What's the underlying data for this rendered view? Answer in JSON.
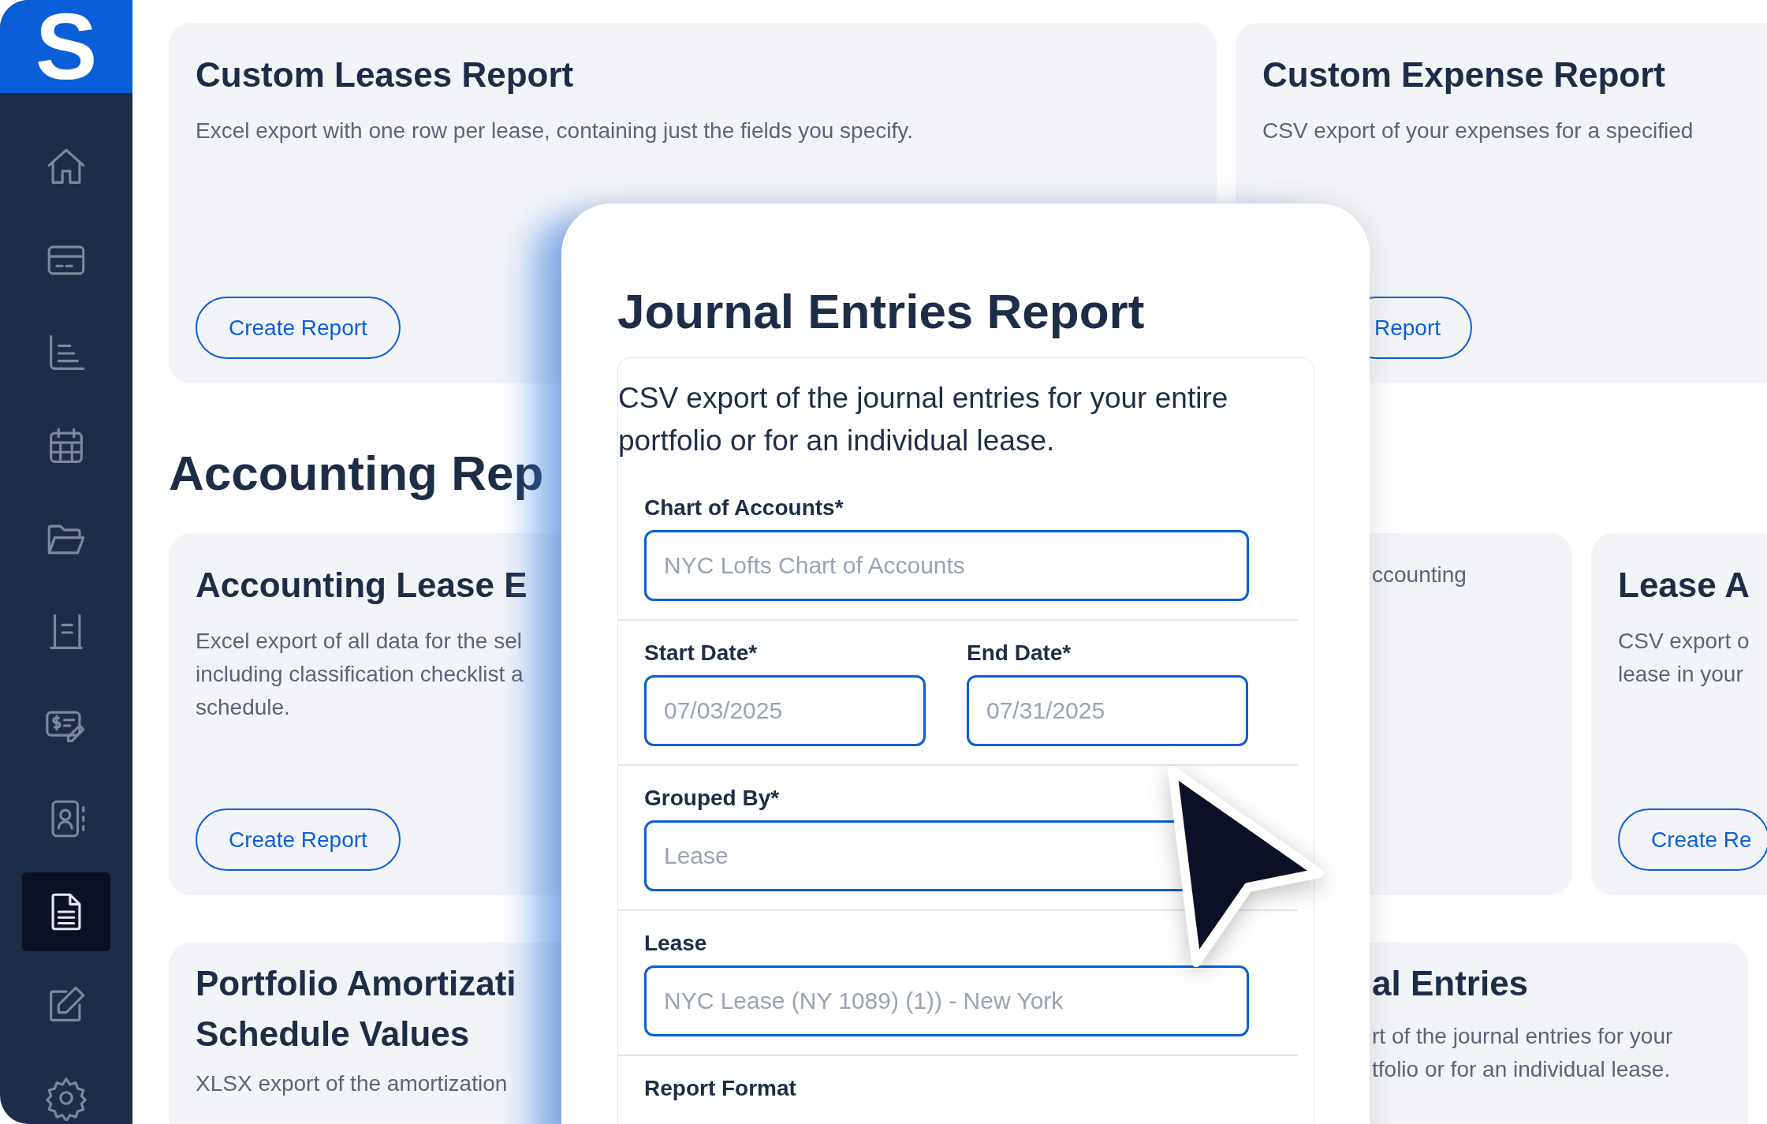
{
  "sidebar": {
    "logo": "S",
    "items": [
      {
        "kind": "home",
        "selected": false
      },
      {
        "kind": "card",
        "selected": false
      },
      {
        "kind": "chart",
        "selected": false
      },
      {
        "kind": "calendar",
        "selected": false
      },
      {
        "kind": "folder",
        "selected": false
      },
      {
        "kind": "ledger",
        "selected": false
      },
      {
        "kind": "payment",
        "selected": false
      },
      {
        "kind": "contacts",
        "selected": false
      },
      {
        "kind": "document",
        "selected": true
      },
      {
        "kind": "edit",
        "selected": false
      },
      {
        "kind": "gear",
        "selected": false
      }
    ]
  },
  "top_cards": [
    {
      "title_lines": [
        "Custom Leases Report"
      ],
      "description_lines": [
        "Excel export with one row per lease, containing just the fields you specify."
      ],
      "button": "Create Report"
    },
    {
      "title_lines": [
        "Custom Expense Report"
      ],
      "description_lines": [
        "CSV export of your expenses for a specified"
      ],
      "button": "Report"
    }
  ],
  "section_heading": "Accounting Rep",
  "accounting_cards": [
    {
      "title_lines": [
        "Accounting Lease E"
      ],
      "description_lines": [
        "Excel export of all data for the sel",
        "including classification checklist a",
        "schedule."
      ],
      "button": "Create Report"
    },
    {
      "description_lines": [
        "ccounting"
      ]
    },
    {
      "title_lines": [
        "Lease A"
      ],
      "description_lines": [
        "CSV export o",
        "lease in your"
      ],
      "button": "Create Re"
    }
  ],
  "bottom_cards": [
    {
      "title_lines": [
        "Portfolio Amortizati",
        "Schedule Values"
      ],
      "description_lines": [
        "XLSX export of the amortization"
      ]
    },
    {
      "title_lines": [
        "al Entries"
      ],
      "description_lines": [
        "rt of the journal entries for your",
        "tfolio or for an individual lease."
      ]
    }
  ],
  "dialog": {
    "title": "Journal Entries Report",
    "description": "CSV export of the journal entries for your entire portfolio or for an individual lease.",
    "field_groups": [
      [
        {
          "label": "Chart of Accounts*",
          "placeholder": "NYC Lofts Chart of Accounts"
        }
      ],
      [
        {
          "label": "Start Date*",
          "placeholder": "07/03/2025"
        },
        {
          "label": "End Date*",
          "placeholder": "07/31/2025"
        }
      ],
      [
        {
          "label": "Grouped By*",
          "placeholder": "Lease"
        }
      ],
      [
        {
          "label": "Lease",
          "placeholder": "NYC Lease (NY 1089) (1)) - New York"
        }
      ],
      [
        {
          "label": "Report Format"
        }
      ]
    ]
  }
}
